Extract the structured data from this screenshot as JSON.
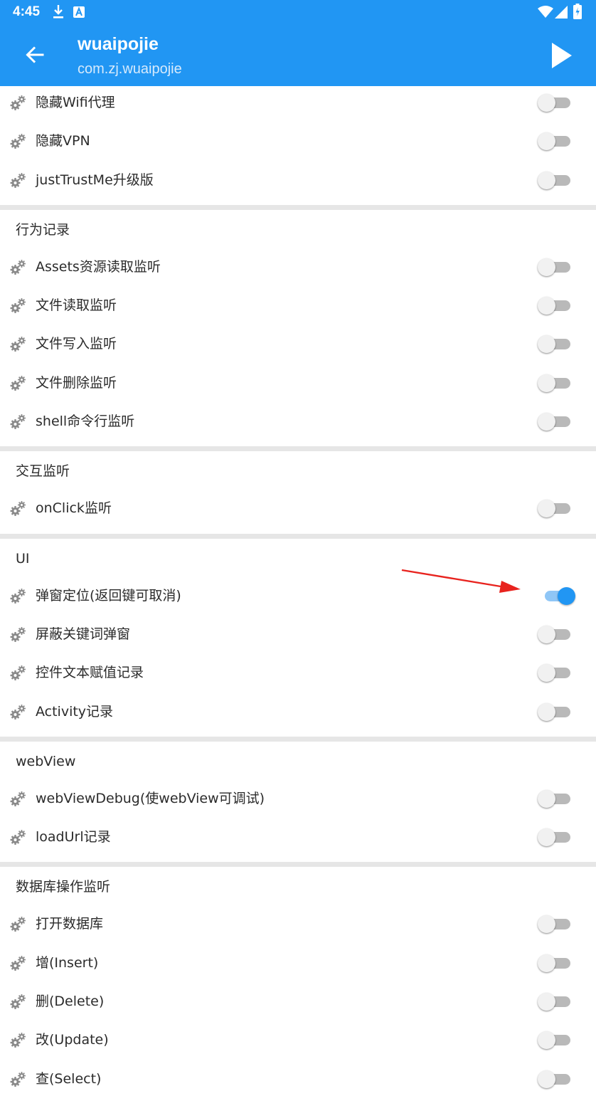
{
  "status_bar": {
    "time": "4:45",
    "icons": [
      "download-icon",
      "notification-a-icon",
      "wifi-icon",
      "signal-icon",
      "battery-icon"
    ]
  },
  "app_bar": {
    "title": "wuaipojie",
    "subtitle": "com.zj.wuaipojie",
    "back_icon": "arrow-back-icon",
    "run_icon": "play-icon"
  },
  "colors": {
    "primary": "#2196F3",
    "switch_on_track": "#8fc6f6",
    "switch_off_track": "#b9b9b9",
    "annotation_arrow": "#e8231e"
  },
  "groups": [
    {
      "header": "",
      "items": [
        {
          "label": "隐藏Wifi代理",
          "on": false
        },
        {
          "label": "隐藏VPN",
          "on": false
        },
        {
          "label": "justTrustMe升级版",
          "on": false
        }
      ]
    },
    {
      "header": "行为记录",
      "items": [
        {
          "label": "Assets资源读取监听",
          "on": false
        },
        {
          "label": "文件读取监听",
          "on": false
        },
        {
          "label": "文件写入监听",
          "on": false
        },
        {
          "label": "文件删除监听",
          "on": false
        },
        {
          "label": "shell命令行监听",
          "on": false
        }
      ]
    },
    {
      "header": "交互监听",
      "items": [
        {
          "label": "onClick监听",
          "on": false
        }
      ]
    },
    {
      "header": "UI",
      "items": [
        {
          "label": "弹窗定位(返回键可取消)",
          "on": true
        },
        {
          "label": "屏蔽关键词弹窗",
          "on": false
        },
        {
          "label": "控件文本赋值记录",
          "on": false
        },
        {
          "label": "Activity记录",
          "on": false
        }
      ]
    },
    {
      "header": "webView",
      "items": [
        {
          "label": "webViewDebug(使webView可调试)",
          "on": false
        },
        {
          "label": "loadUrl记录",
          "on": false
        }
      ]
    },
    {
      "header": "数据库操作监听",
      "items": [
        {
          "label": "打开数据库",
          "on": false
        },
        {
          "label": "增(Insert)",
          "on": false
        },
        {
          "label": "删(Delete)",
          "on": false
        },
        {
          "label": "改(Update)",
          "on": false
        },
        {
          "label": "查(Select)",
          "on": false
        }
      ]
    }
  ]
}
